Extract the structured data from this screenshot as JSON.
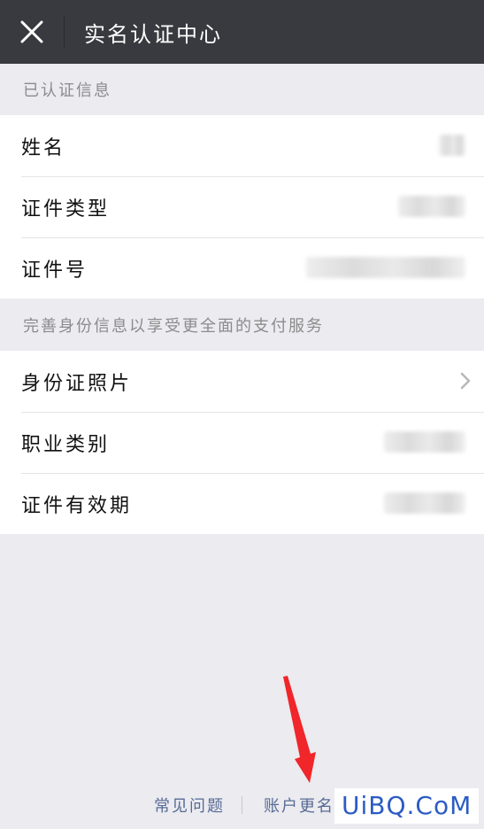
{
  "nav": {
    "title": "实名认证中心",
    "close_icon": "close-icon"
  },
  "section_verified": {
    "header": "已认证信息",
    "rows": [
      {
        "label": "姓名"
      },
      {
        "label": "证件类型"
      },
      {
        "label": "证件号"
      }
    ]
  },
  "section_improve": {
    "header": "完善身份信息以享受更全面的支付服务",
    "rows": [
      {
        "label": "身份证照片",
        "icon": "chevron-right-icon"
      },
      {
        "label": "职业类别"
      },
      {
        "label": "证件有效期"
      }
    ]
  },
  "footer": {
    "faq_link": "常见问题",
    "rename_link": "账户更名"
  },
  "watermark": "UiBQ.CoM",
  "colors": {
    "nav_bg": "#393a3f",
    "page_bg": "#ebebf0",
    "link": "#576b95",
    "arrow": "#f0262a",
    "watermark": "#2b5cc4"
  }
}
